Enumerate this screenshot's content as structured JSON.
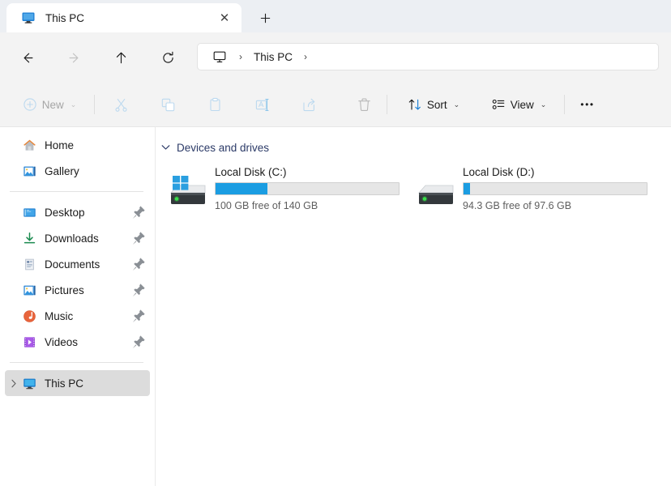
{
  "window": {
    "tabs": [
      {
        "label": "This PC",
        "icon": "this-pc-monitor-icon",
        "active": true
      }
    ],
    "close_glyph": "✕",
    "newtab_glyph": "＋"
  },
  "nav": {
    "back_label": "Back",
    "forward_label": "Forward",
    "up_label": "Up",
    "refresh_label": "Refresh",
    "breadcrumb": {
      "root_icon": "monitor-icon",
      "separator": "›",
      "items": [
        "This PC"
      ]
    }
  },
  "toolbar": {
    "new_label": "New",
    "cut_label": "Cut",
    "copy_label": "Copy",
    "paste_label": "Paste",
    "rename_label": "Rename",
    "share_label": "Share",
    "delete_label": "Delete",
    "sort_label": "Sort",
    "view_label": "View",
    "more_label": "•••",
    "chevron": "⌄"
  },
  "sidebar": {
    "items": [
      {
        "label": "Home",
        "icon": "home-icon",
        "pinned": false,
        "selected": false,
        "expander": false
      },
      {
        "label": "Gallery",
        "icon": "gallery-icon",
        "pinned": false,
        "selected": false,
        "expander": false
      },
      {
        "label": "Desktop",
        "icon": "desktop-icon",
        "pinned": true,
        "selected": false,
        "expander": false
      },
      {
        "label": "Downloads",
        "icon": "downloads-icon",
        "pinned": true,
        "selected": false,
        "expander": false
      },
      {
        "label": "Documents",
        "icon": "documents-icon",
        "pinned": true,
        "selected": false,
        "expander": false
      },
      {
        "label": "Pictures",
        "icon": "pictures-icon",
        "pinned": true,
        "selected": false,
        "expander": false
      },
      {
        "label": "Music",
        "icon": "music-icon",
        "pinned": true,
        "selected": false,
        "expander": false
      },
      {
        "label": "Videos",
        "icon": "videos-icon",
        "pinned": true,
        "selected": false,
        "expander": false
      },
      {
        "label": "This PC",
        "icon": "this-pc-icon",
        "pinned": false,
        "selected": true,
        "expander": true
      }
    ]
  },
  "main": {
    "group_title": "Devices and drives",
    "group_chevron": "⌄",
    "drives": [
      {
        "name": "Local Disk (C:)",
        "free_text": "100 GB free of 140 GB",
        "used_percent": 28.5,
        "has_windows_badge": true,
        "icon": "hard-drive-icon"
      },
      {
        "name": "Local Disk (D:)",
        "free_text": "94.3 GB free of 97.6 GB",
        "used_percent": 3.4,
        "has_windows_badge": false,
        "icon": "hard-drive-icon"
      }
    ]
  },
  "colors": {
    "accent_blue": "#1b9de2",
    "group_header": "#2b3a67",
    "titlebar_bg": "#eceff3",
    "toolbar_bg": "#f3f3f3",
    "selected_row": "#dcdcdc"
  }
}
